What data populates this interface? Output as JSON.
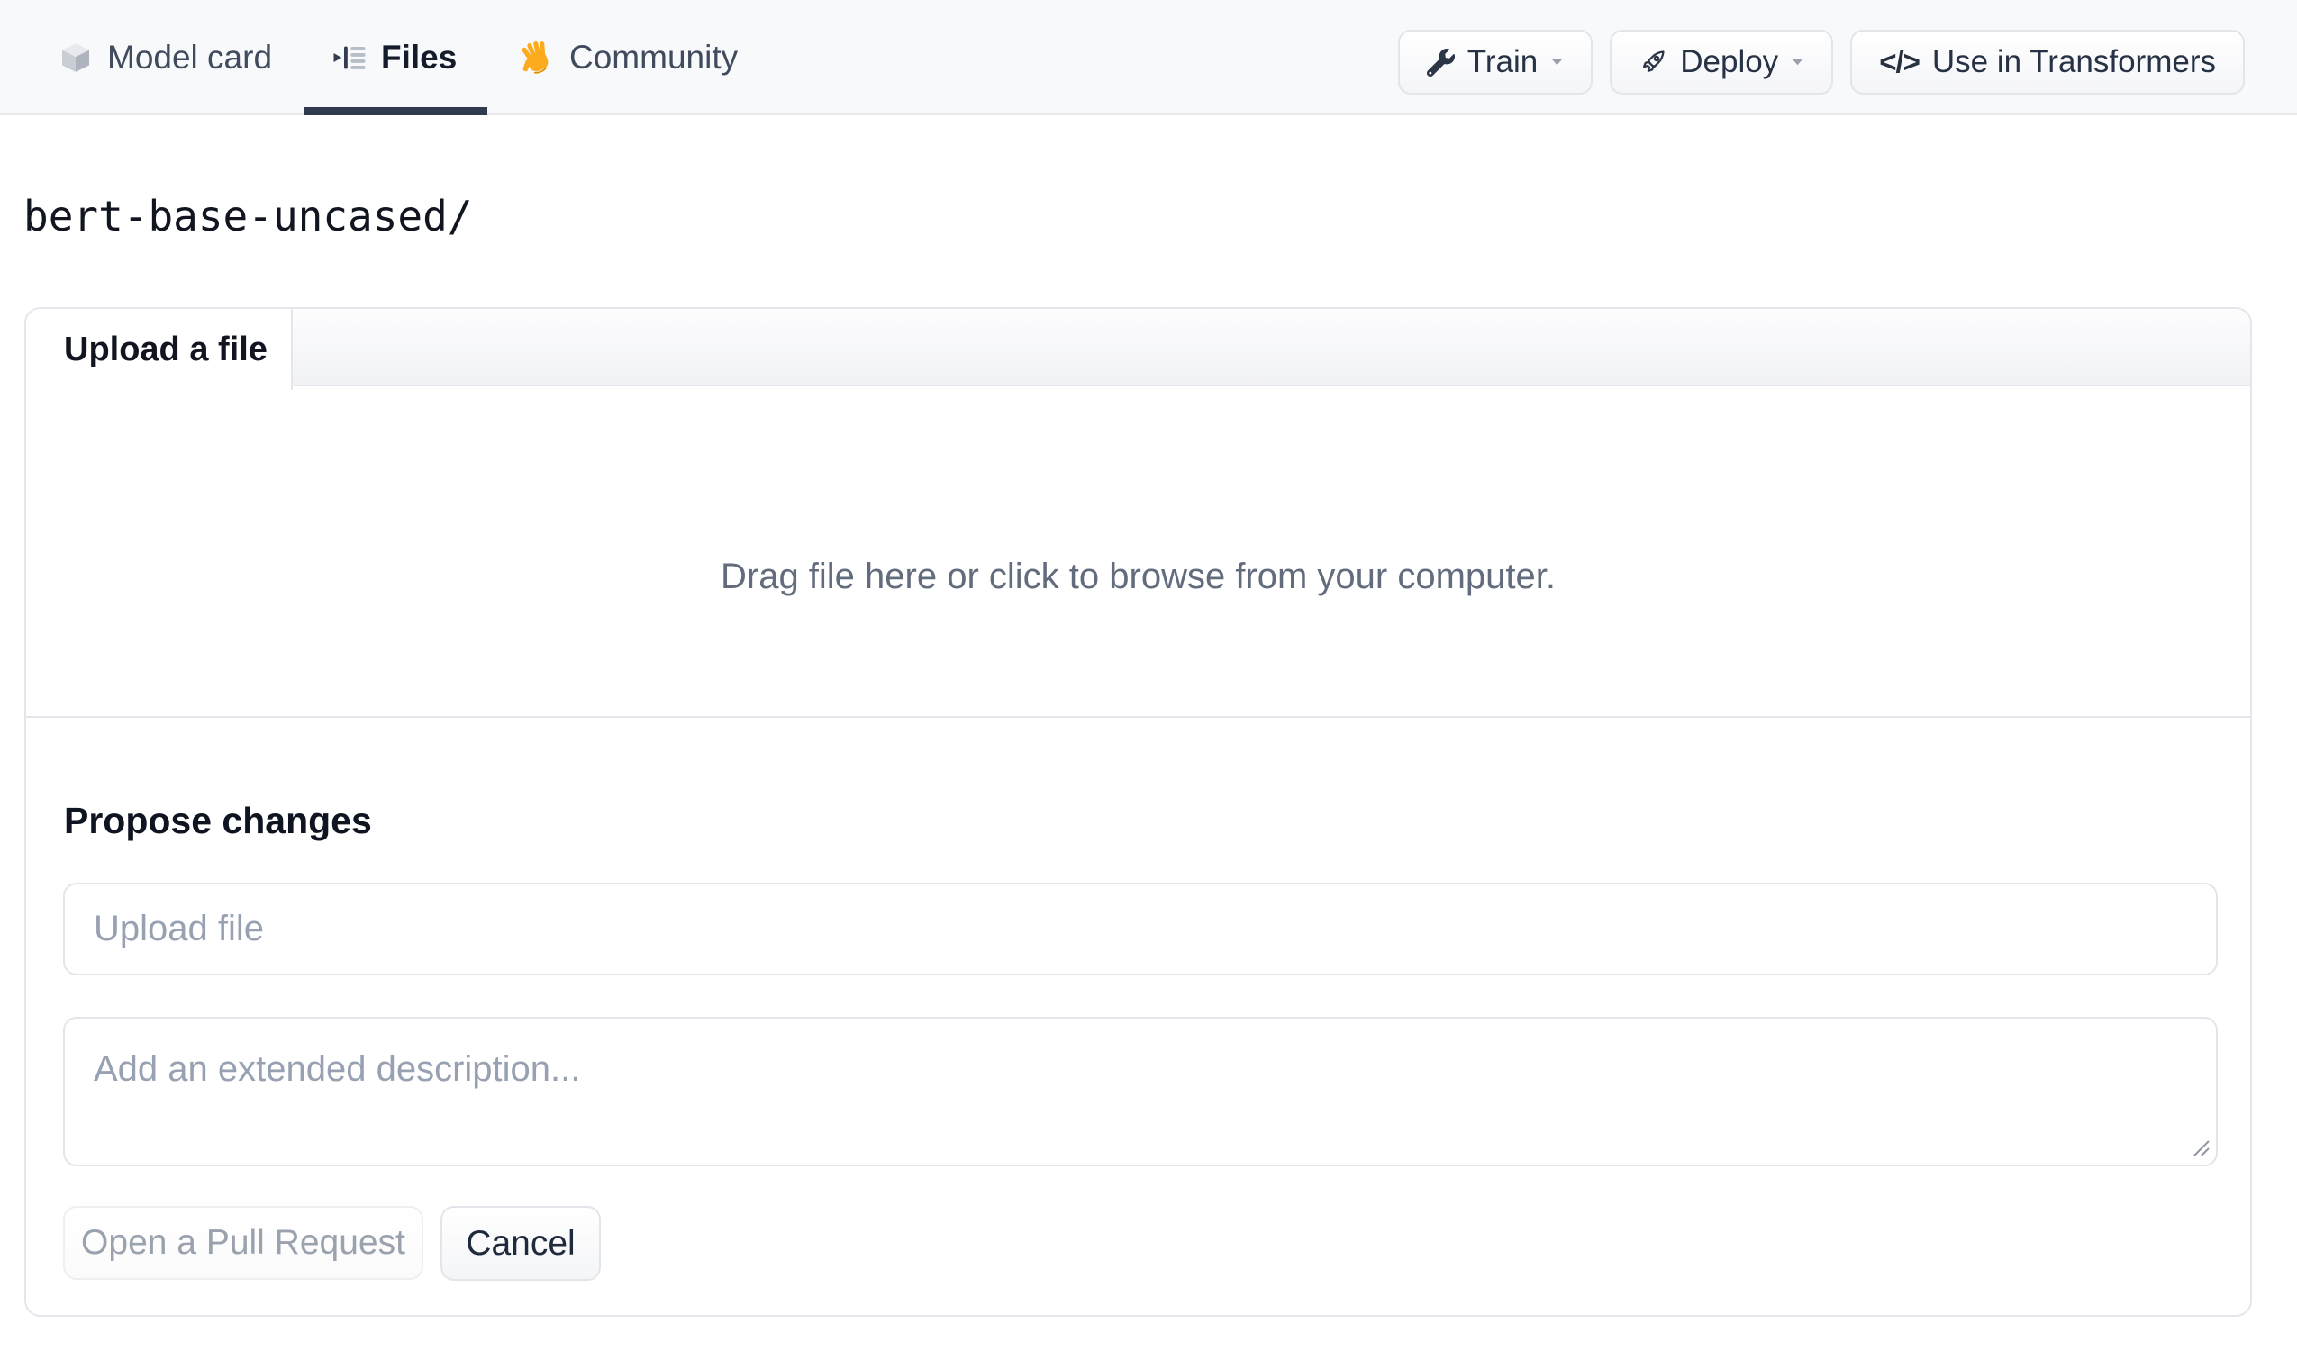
{
  "topbar": {
    "tabs": [
      {
        "label": "Model card",
        "icon": "cube-icon",
        "active": false
      },
      {
        "label": "Files",
        "icon": "files-icon",
        "active": true
      },
      {
        "label": "Community",
        "icon": "waving-hand-icon",
        "active": false
      }
    ],
    "actions": [
      {
        "label": "Train",
        "icon": "wrench-icon",
        "has_caret": true
      },
      {
        "label": "Deploy",
        "icon": "rocket-icon",
        "has_caret": true
      },
      {
        "label": "Use in Transformers",
        "icon": "code-icon",
        "has_caret": false
      }
    ],
    "code_glyph": "</>"
  },
  "breadcrumb": {
    "path": "bert-base-uncased/"
  },
  "upload_panel": {
    "tab_label": "Upload a file",
    "dropzone_text": "Drag file here or click to browse from your computer.",
    "propose": {
      "heading": "Propose changes",
      "file_placeholder": "Upload file",
      "description_placeholder": "Add an extended description...",
      "open_pr_label": "Open a Pull Request",
      "cancel_label": "Cancel"
    }
  },
  "colors": {
    "topbar_bg": "#f8f9fb",
    "active_tab_underline": "#2f3a4e",
    "border": "#e4e6eb",
    "muted_text": "#626c7d",
    "placeholder": "#98a1b1",
    "disabled_button_text": "#9aa2ae",
    "dark_text": "#10151f",
    "hand_emoji_color": "#fbab1d"
  }
}
